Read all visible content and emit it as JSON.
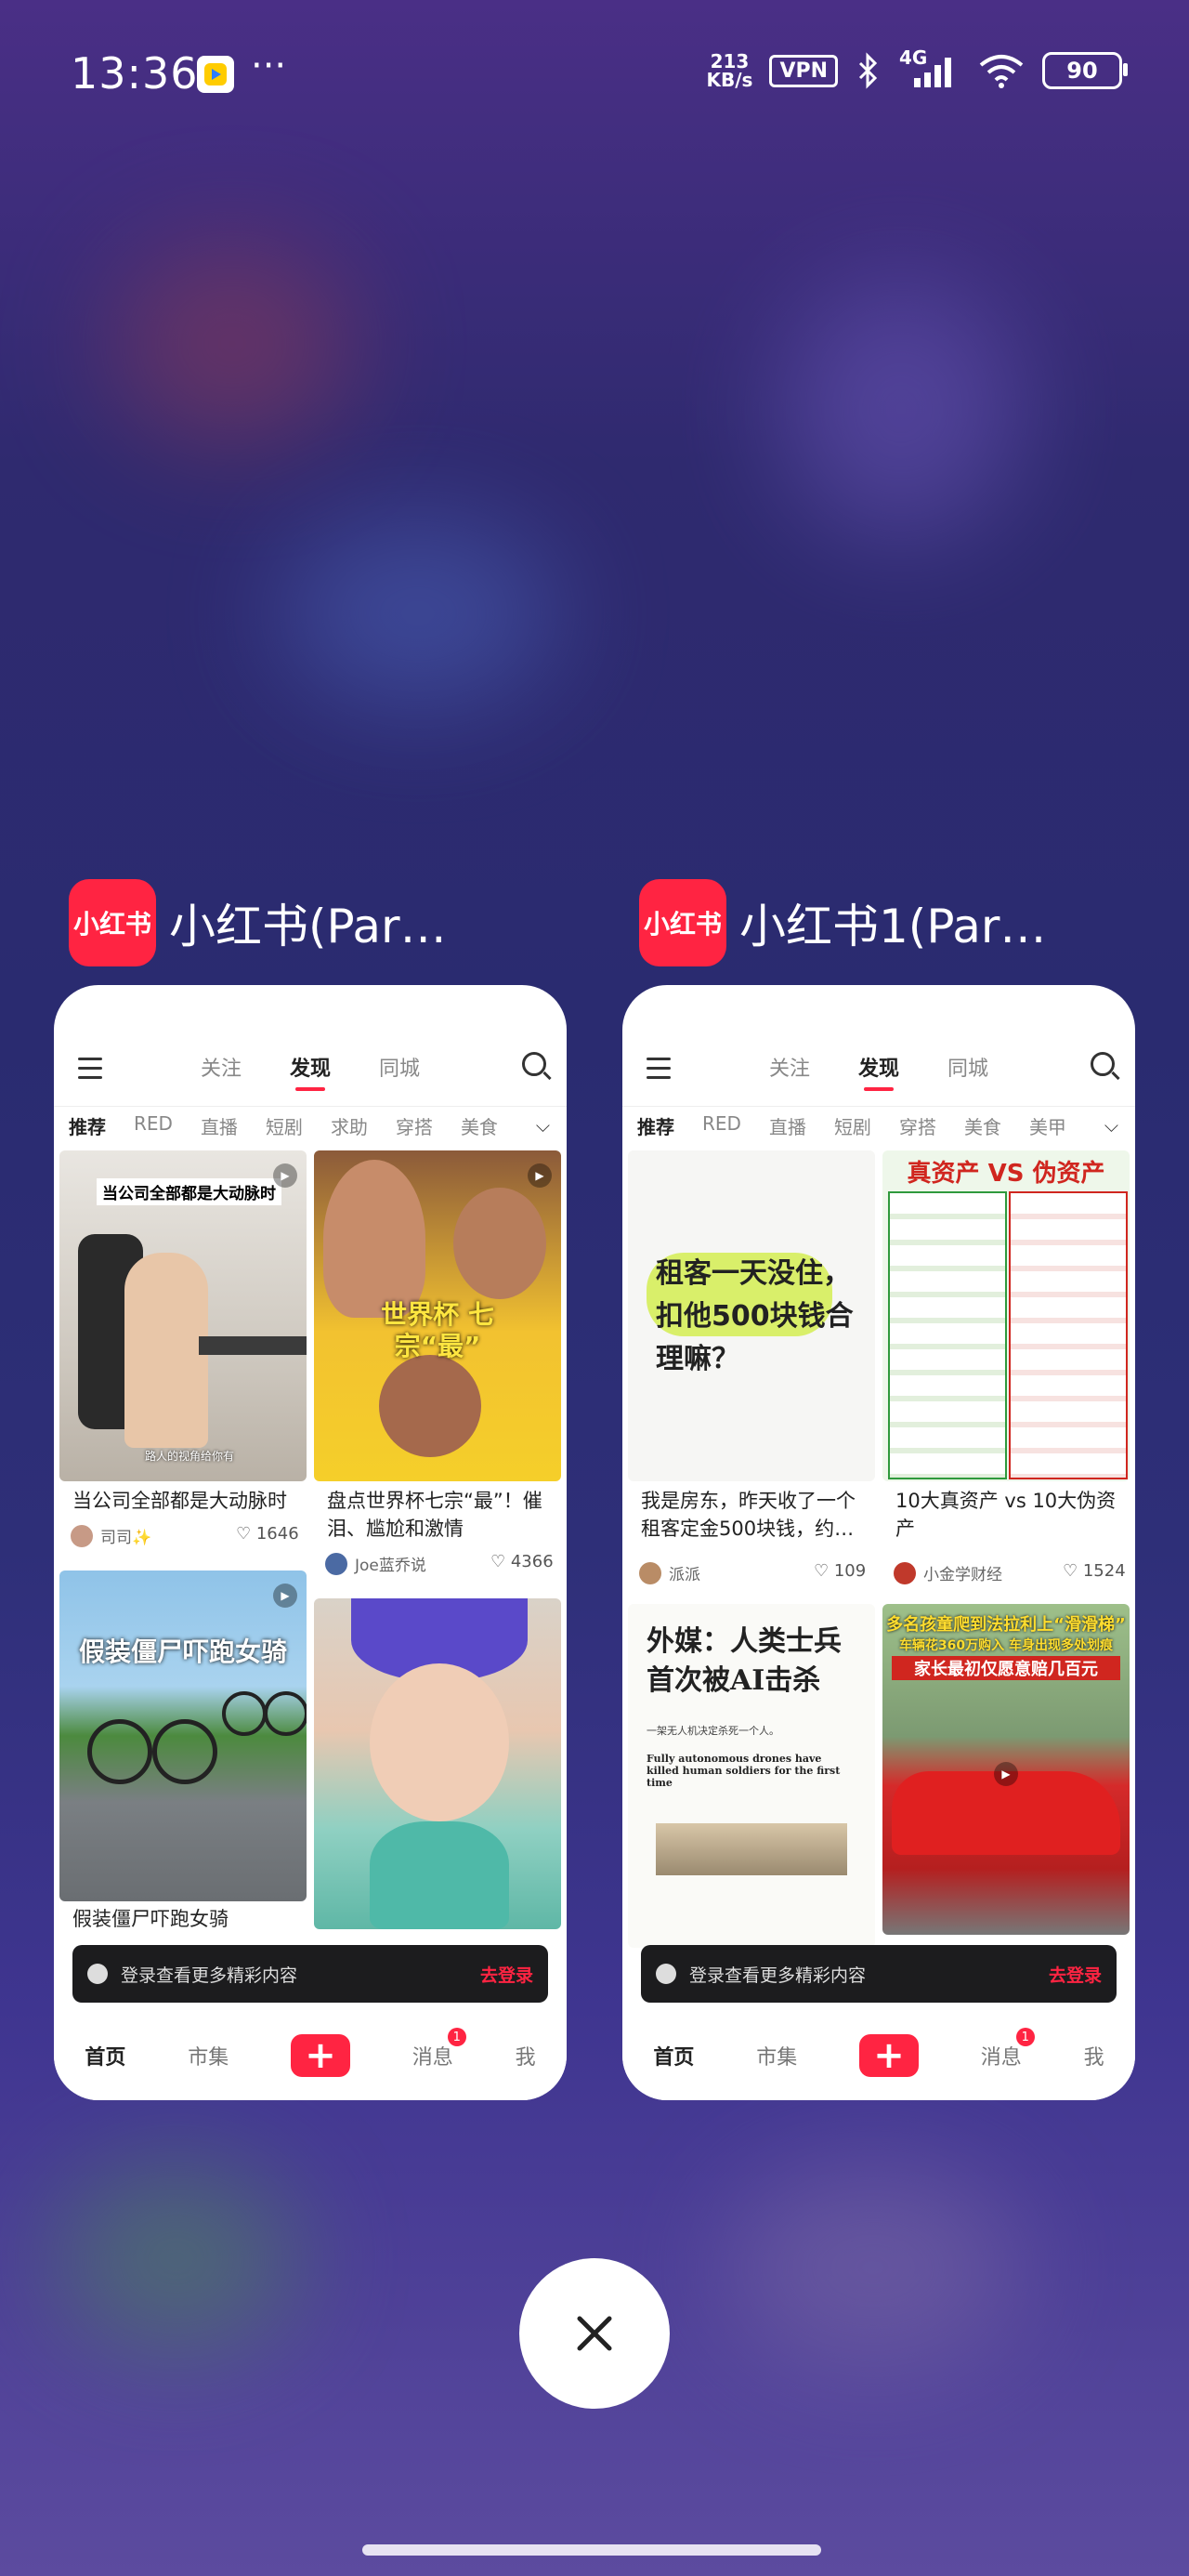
{
  "status": {
    "time": "13:36",
    "speed_value": "213",
    "speed_unit": "KB/s",
    "vpn": "VPN",
    "network": "4G",
    "battery": "90",
    "dots": "···"
  },
  "cards": [
    {
      "app_logo": "小红书",
      "app_name": "小红书(Par…",
      "tabs": [
        "关注",
        "发现",
        "同城"
      ],
      "categories": [
        "推荐",
        "RED",
        "直播",
        "短剧",
        "求助",
        "穿搭",
        "美食"
      ],
      "tiles": [
        {
          "caption": "当公司全部都是大动脉时",
          "title": "当公司全部都是大动脉时",
          "sub": "路人的视角给你有",
          "author": "司司✨",
          "likes": "1646"
        },
        {
          "caption": "世界杯 七宗“最”",
          "title": "盘点世界杯七宗“最”！催泪、尴尬和激情",
          "author": "Joe蓝乔说",
          "likes": "4366"
        },
        {
          "caption": "假装僵尸吓跑女骑",
          "title": "假装僵尸吓跑女骑"
        },
        {
          "caption": "",
          "title": ""
        }
      ],
      "login_text": "登录查看更多精彩内容",
      "login_action": "去登录",
      "bottom": {
        "home": "首页",
        "market": "市集",
        "plus": "+",
        "messages": "消息",
        "me": "我",
        "badge": "1"
      }
    },
    {
      "app_logo": "小红书",
      "app_name": "小红书1(Par…",
      "tabs": [
        "关注",
        "发现",
        "同城"
      ],
      "categories": [
        "推荐",
        "RED",
        "直播",
        "短剧",
        "穿搭",
        "美食",
        "美甲"
      ],
      "tiles": [
        {
          "caption": "租客一天没住，扣他500块钱合理嘛？",
          "title": "我是房东，昨天收了一个租客定金500块钱，约…",
          "author": "派派",
          "likes": "109"
        },
        {
          "caption": "真资产 VS 伪资产",
          "title": "10大真资产 vs 10大伪资产",
          "author": "小金学财经",
          "likes": "1524"
        },
        {
          "caption": "外媒：人类士兵首次被AI击杀",
          "sub": "一架无人机决定杀死一个人。",
          "en": "Fully autonomous drones have killed human soldiers for the first time"
        },
        {
          "caption": "多名孩童爬到法拉利上“滑滑梯”",
          "sub1": "车辆花360万购入 车身出现多处划痕",
          "sub2": "家长最初仅愿意赔几百元"
        }
      ],
      "login_text": "登录查看更多精彩内容",
      "login_action": "去登录",
      "bottom": {
        "home": "首页",
        "market": "市集",
        "plus": "+",
        "messages": "消息",
        "me": "我",
        "badge": "1"
      }
    }
  ],
  "close_label": "×"
}
